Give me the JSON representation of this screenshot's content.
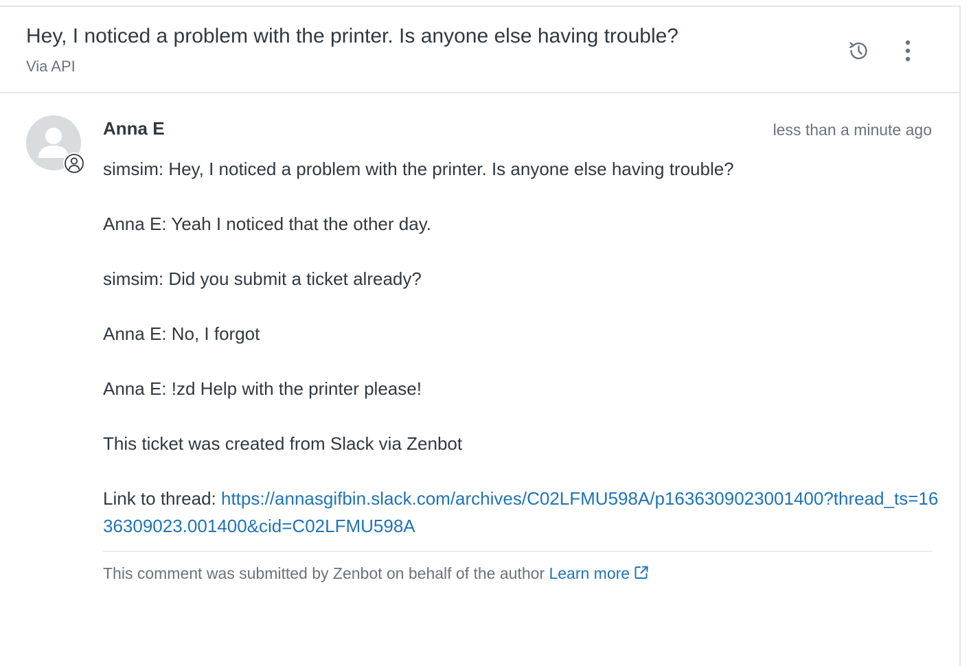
{
  "ticket": {
    "title": "Hey, I noticed a problem with the printer. Is anyone else having trouble?",
    "via": "Via API"
  },
  "comment": {
    "author": "Anna E",
    "timestamp": "less than a minute ago",
    "lines": [
      "simsim: Hey, I noticed a problem with the printer. Is anyone else having trouble?",
      "Anna E: Yeah I noticed that the other day.",
      "simsim: Did you submit a ticket already?",
      "Anna E: No, I forgot",
      "Anna E: !zd Help with the printer please!",
      "This ticket was created from Slack via Zenbot"
    ],
    "link_label": "Link to thread: ",
    "link_url": "https://annasgifbin.slack.com/archives/C02LFMU598A/p1636309023001400?thread_ts=1636309023.001400&cid=C02LFMU598A",
    "footer_text": "This comment was submitted by Zenbot on behalf of the author ",
    "learn_more": "Learn more"
  },
  "icons": {
    "history": "history-icon",
    "more": "more-vertical-icon",
    "avatar": "user-avatar-icon",
    "badge": "user-circle-icon",
    "external": "external-link-icon"
  },
  "colors": {
    "text": "#2f3941",
    "muted": "#68737d",
    "link": "#1f73b7",
    "border": "#e4e7e9",
    "avatar_bg": "#d8dcde"
  }
}
